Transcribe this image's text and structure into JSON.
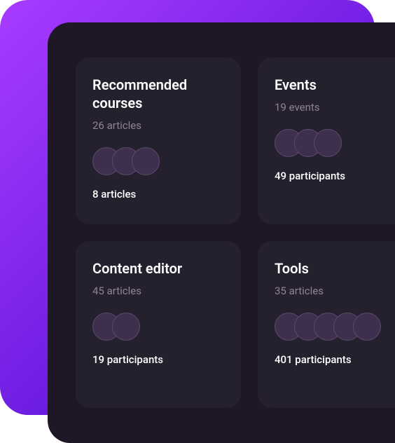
{
  "cards": [
    {
      "title": "Recommended courses",
      "sub": "26 articles",
      "avatars": 3,
      "foot": "8 articles"
    },
    {
      "title": "Events",
      "sub": "19 events",
      "avatars": 3,
      "foot": "49 participants"
    },
    {
      "title": "Content editor",
      "sub": "45 articles",
      "avatars": 2,
      "foot": "19 participants"
    },
    {
      "title": "Tools",
      "sub": "35 articles",
      "avatars": 5,
      "foot": "401 participants"
    }
  ]
}
